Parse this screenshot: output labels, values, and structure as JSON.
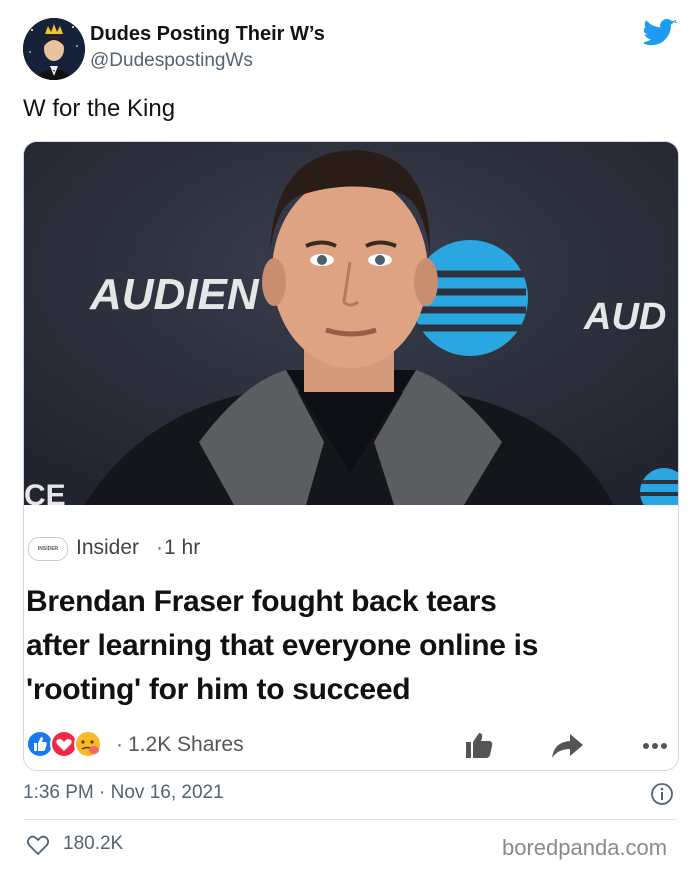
{
  "author": {
    "name": "Dudes Posting Their W’s",
    "handle": "@DudespostingWs"
  },
  "tweet": {
    "text": "W for the King",
    "timestamp": "1:36 PM · Nov 16, 2021",
    "likes": "180.2K"
  },
  "embedded_post": {
    "photo_signs": {
      "left": "AUDIEN",
      "right": "AUD"
    },
    "source": "Insider",
    "source_logo": "INSIDER",
    "separator": "·",
    "time_ago": "1 hr",
    "headline_lines": [
      "Brendan Fraser fought back tears",
      "after learning that everyone online is",
      "'rooting' for him to succeed"
    ],
    "shares": "1.2K Shares"
  },
  "watermark": "boredpanda.com",
  "colors": {
    "twitter_blue": "#1d9bf0",
    "secondary_text": "#536471",
    "att_blue": "#2aa7e0"
  },
  "icons": [
    "twitter-bird-icon",
    "facebook-like-icon",
    "share-arrow-icon",
    "more-icon",
    "info-icon",
    "heart-icon"
  ]
}
